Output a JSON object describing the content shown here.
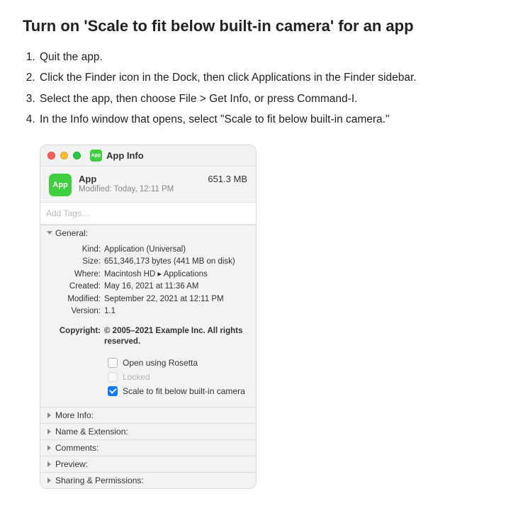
{
  "heading": "Turn on 'Scale to fit below built-in camera' for an app",
  "steps": [
    "Quit the app.",
    "Click the Finder icon in the Dock, then click Applications in the Finder sidebar.",
    "Select the app, then choose File > Get Info, or press Command-I.",
    "In the Info window that opens, select \"Scale to fit below built-in camera.\""
  ],
  "window": {
    "badge_text": "App",
    "title": "App Info",
    "app_name": "App",
    "modified_top": "Modified: Today, 12:11 PM",
    "size_top": "651.3 MB",
    "tags_placeholder": "Add Tags…",
    "general_label": "General:",
    "fields": {
      "kind_label": "Kind:",
      "kind_value": "Application (Universal)",
      "size_label": "Size:",
      "size_value": "651,346,173 bytes (441 MB on disk)",
      "where_label": "Where:",
      "where_value": "Macintosh HD ▸ Applications",
      "created_label": "Created:",
      "created_value": "May 16, 2021 at 11:36 AM",
      "modified_label": "Modified:",
      "modified_value": "September 22, 2021 at 12:11 PM",
      "version_label": "Version:",
      "version_value": "1.1",
      "copyright_label": "Copyright:",
      "copyright_value": "© 2005–2021 Example Inc. All rights reserved."
    },
    "options": {
      "rosetta": "Open using Rosetta",
      "locked": "Locked",
      "scale": "Scale to fit below built-in camera"
    },
    "sections": {
      "more_info": "More Info:",
      "name_ext": "Name & Extension:",
      "comments": "Comments:",
      "preview": "Preview:",
      "sharing": "Sharing & Permissions:"
    }
  }
}
